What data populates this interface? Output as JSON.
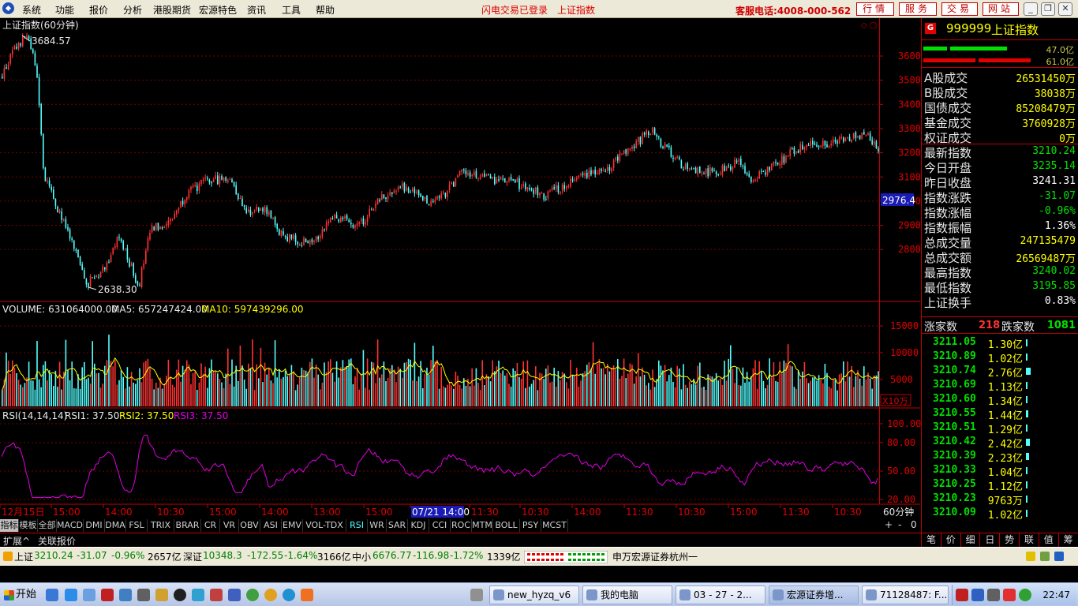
{
  "menu": [
    "系统",
    "功能",
    "报价",
    "分析",
    "港股期货",
    "宏源特色",
    "资讯",
    "工具",
    "帮助"
  ],
  "top_status": {
    "login": "闪电交易已登录",
    "index": "上证指数"
  },
  "hotline": "客服电话:4008-000-562",
  "top_buttons": [
    "行情",
    "服务",
    "交易",
    "网站"
  ],
  "main_chart": {
    "title": "上证指数(60分钟)",
    "high_label": "3684.57",
    "low_label": "2638.30",
    "price_ticks": [
      "3600",
      "3500",
      "3400",
      "3300",
      "3200",
      "3100",
      "3000",
      "2900",
      "2800"
    ],
    "current_marker": "2976.4",
    "colors": {
      "up": "#ff3232",
      "down": "#54ffff",
      "grid": "#a00000",
      "ma": "#ffff00",
      "rsi": "#e000e0"
    }
  },
  "volume": {
    "label": "VOLUME: 631064000.00",
    "ma5": "MA5: 657247424.00",
    "ma10": "MA10: 597439296.00",
    "ticks": [
      "15000",
      "10000",
      "5000"
    ],
    "unit": "X10万"
  },
  "rsi": {
    "label": "RSI(14,14,14)",
    "rsi1": "RSI1: 37.50",
    "rsi2": "RSI2: 37.50",
    "rsi3": "RSI3: 37.50",
    "ticks": [
      "100.00",
      "80.00",
      "50.00",
      "20.00"
    ]
  },
  "time_axis": {
    "labels": [
      "12月15日",
      "15:00",
      "14:00",
      "10:30",
      "15:00",
      "14:00",
      "13:00",
      "15:00",
      "07/21 14:00",
      "11:30",
      "10:30",
      "14:00",
      "11:30",
      "10:30",
      "15:00",
      "11:30",
      "10:30"
    ],
    "period": "60分钟"
  },
  "indicator_tabs": [
    "指标",
    "模板",
    "全部",
    "MACD",
    "DMI",
    "DMA",
    "FSL",
    "TRIX",
    "BRAR",
    "CR",
    "VR",
    "OBV",
    "ASI",
    "EMV",
    "VOL-TDX",
    "RSI",
    "WR",
    "SAR",
    "KDJ",
    "CCI",
    "ROC",
    "MTM",
    "BOLL",
    "PSY",
    "MCST"
  ],
  "zoom_controls": [
    "+",
    "-",
    "0"
  ],
  "expand_tabs": [
    "扩展^",
    "关联报价"
  ],
  "side_panel": {
    "code": "999999",
    "name": "上证指数",
    "g_label": "G",
    "amount_top": "47.0亿",
    "amount_bottom": "61.0亿",
    "info": [
      {
        "label": "A股成交",
        "value": "26531450万",
        "color": "#ffff00"
      },
      {
        "label": "B股成交",
        "value": "38038万",
        "color": "#ffff00"
      },
      {
        "label": "国债成交",
        "value": "85208479万",
        "color": "#ffff00"
      },
      {
        "label": "基金成交",
        "value": "3760928万",
        "color": "#ffff00"
      },
      {
        "label": "权证成交",
        "value": "0万",
        "color": "#ffff00"
      },
      {
        "label": "最新指数",
        "value": "3210.24",
        "color": "#00e000"
      },
      {
        "label": "今日开盘",
        "value": "3235.14",
        "color": "#00e000"
      },
      {
        "label": "昨日收盘",
        "value": "3241.31",
        "color": "#ffffff"
      },
      {
        "label": "指数涨跌",
        "value": "-31.07",
        "color": "#00e000"
      },
      {
        "label": "指数涨幅",
        "value": "-0.96%",
        "color": "#00e000"
      },
      {
        "label": "指数振幅",
        "value": "1.36%",
        "color": "#ffffff"
      },
      {
        "label": "总成交量",
        "value": "247135479",
        "color": "#ffff00"
      },
      {
        "label": "总成交额",
        "value": "26569487万",
        "color": "#ffff00"
      },
      {
        "label": "最高指数",
        "value": "3240.02",
        "color": "#00e000"
      },
      {
        "label": "最低指数",
        "value": "3195.85",
        "color": "#00e000"
      },
      {
        "label": "上证换手",
        "value": "0.83%",
        "color": "#ffffff"
      }
    ],
    "up_label": "涨家数",
    "up_count": "218",
    "down_label": "跌家数",
    "down_count": "1081",
    "ticks": [
      {
        "price": "3211.05",
        "amount": "1.30亿",
        "bar": 0.2
      },
      {
        "price": "3210.89",
        "amount": "1.02亿",
        "bar": 0.15
      },
      {
        "price": "3210.74",
        "amount": "2.76亿",
        "bar": 0.7
      },
      {
        "price": "3210.69",
        "amount": "1.13亿",
        "bar": 0.2
      },
      {
        "price": "3210.60",
        "amount": "1.34亿",
        "bar": 0.25
      },
      {
        "price": "3210.55",
        "amount": "1.44亿",
        "bar": 0.4
      },
      {
        "price": "3210.51",
        "amount": "1.29亿",
        "bar": 0.25
      },
      {
        "price": "3210.42",
        "amount": "2.42亿",
        "bar": 0.6
      },
      {
        "price": "3210.39",
        "amount": "2.23亿",
        "bar": 0.55
      },
      {
        "price": "3210.33",
        "amount": "1.04亿",
        "bar": 0.15
      },
      {
        "price": "3210.25",
        "amount": "1.12亿",
        "bar": 0.15
      },
      {
        "price": "3210.23",
        "amount": "9763万",
        "bar": 0.0
      },
      {
        "price": "3210.09",
        "amount": "1.02亿",
        "bar": 0.15
      }
    ],
    "bottom_tabs": [
      "笔",
      "价",
      "细",
      "日",
      "势",
      "联",
      "值",
      "筹"
    ]
  },
  "status_bar": {
    "sh_name": "上证",
    "sh_value": "3210.24",
    "sh_change": "-31.07",
    "sh_pct": "-0.96%",
    "sh_amount": "2657亿",
    "sz_name": "深证",
    "sz_value": "10348.3",
    "sz_change": "-172.55",
    "sz_pct": "-1.64%",
    "sz_amount": "3166亿",
    "zx_name": "中小",
    "zx_value": "6676.77",
    "zx_change": "-116.98",
    "zx_pct": "-1.72%",
    "zx_amount": "1339亿",
    "broker": "申万宏源证券杭州一"
  },
  "taskbar": {
    "start": "开始",
    "tasks": [
      "new_hyzq_v6",
      "我的电脑",
      "03 - 27 - 2...",
      "宏源证券增...",
      "71128487: F..."
    ],
    "clock": "22:47"
  }
}
